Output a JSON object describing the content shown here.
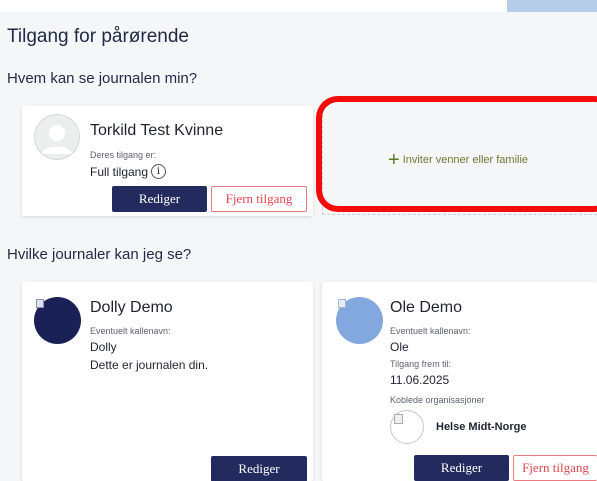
{
  "page": {
    "title": "Tilgang for pårørende",
    "who_can_see_heading": "Hvem kan se journalen min?",
    "which_can_i_see_heading": "Hvilke journaler kan jeg se?"
  },
  "access_card": {
    "name": "Torkild Test Kvinne",
    "access_label": "Deres tilgang er:",
    "access_value": "Full tilgang",
    "edit_label": "Rediger",
    "remove_label": "Fjern tilgang"
  },
  "invite": {
    "label": "Inviter venner eller familie"
  },
  "journal_cards": [
    {
      "name": "Dolly Demo",
      "nickname_label": "Eventuelt kallenavn:",
      "nickname_value": "Dolly",
      "note": "Dette er journalen din.",
      "edit_label": "Rediger"
    },
    {
      "name": "Ole Demo",
      "nickname_label": "Eventuelt kallenavn:",
      "nickname_value": "Ole",
      "access_until_label": "Tilgang frem til:",
      "access_until_value": "11.06.2025",
      "orgs_label": "Koblede organisasjoner",
      "org_name": "Helse Midt-Norge",
      "edit_label": "Rediger",
      "remove_label": "Fjern tilgang"
    }
  ],
  "colors": {
    "primary_button": "#232b5e",
    "danger": "#e0464f",
    "highlight": "#f20c0c",
    "invite_text": "#6a7a35"
  }
}
